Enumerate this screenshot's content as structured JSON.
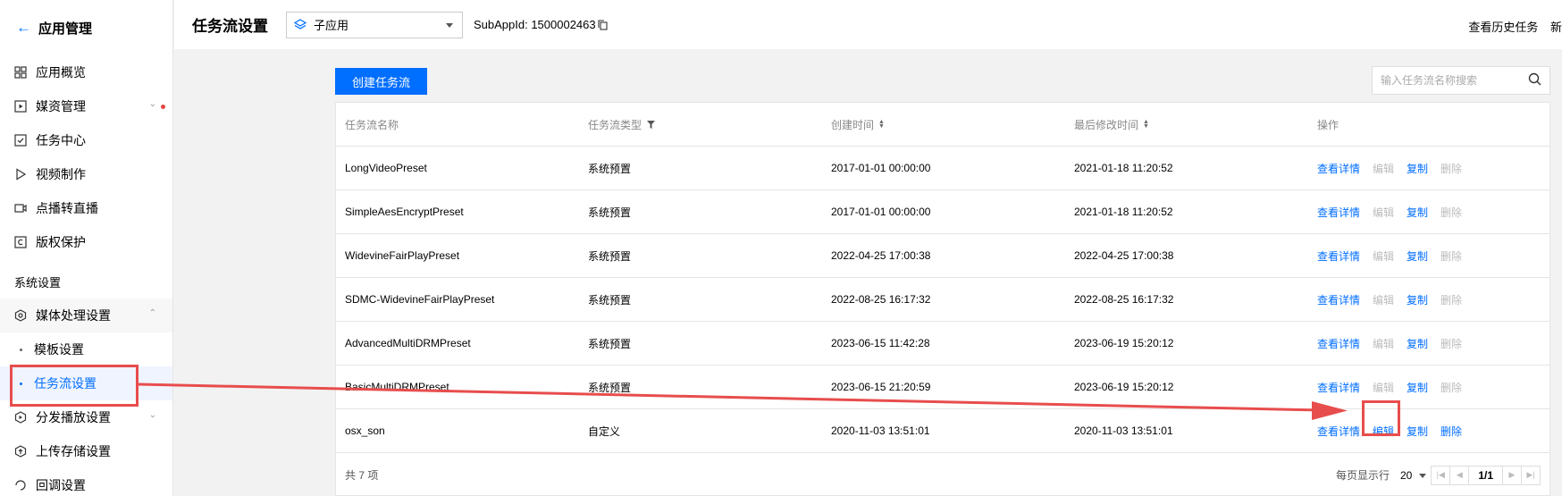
{
  "sidebar": {
    "header": "应用管理",
    "items": [
      {
        "label": "应用概览",
        "icon": "grid-icon"
      },
      {
        "label": "媒资管理",
        "icon": "media-play-icon"
      },
      {
        "label": "任务中心",
        "icon": "task-check-icon"
      },
      {
        "label": "视频制作",
        "icon": "play-triangle-icon"
      },
      {
        "label": "点播转直播",
        "icon": "live-video-icon"
      },
      {
        "label": "版权保护",
        "icon": "copyright-icon"
      }
    ],
    "group_title": "系统设置",
    "settings": [
      {
        "label": "媒体处理设置",
        "icon": "hexagon-gear-icon"
      },
      {
        "label": "模板设置"
      },
      {
        "label": "任务流设置"
      },
      {
        "label": "分发播放设置",
        "icon": "distribute-icon"
      },
      {
        "label": "上传存储设置",
        "icon": "upload-storage-icon"
      },
      {
        "label": "回调设置",
        "icon": "callback-icon"
      }
    ]
  },
  "header": {
    "title": "任务流设置",
    "app_select_value": "子应用",
    "subappid": "SubAppId: 1500002463",
    "right_links": [
      "查看历史任务",
      "新"
    ]
  },
  "toolbar": {
    "create_label": "创建任务流",
    "search_placeholder": "输入任务流名称搜索"
  },
  "table": {
    "columns": [
      "任务流名称",
      "任务流类型",
      "创建时间",
      "最后修改时间",
      "操作"
    ],
    "rows": [
      {
        "name": "LongVideoPreset",
        "type": "系统预置",
        "created": "2017-01-01 00:00:00",
        "modified": "2021-01-18 11:20:52",
        "custom": false
      },
      {
        "name": "SimpleAesEncryptPreset",
        "type": "系统预置",
        "created": "2017-01-01 00:00:00",
        "modified": "2021-01-18 11:20:52",
        "custom": false
      },
      {
        "name": "WidevineFairPlayPreset",
        "type": "系统预置",
        "created": "2022-04-25 17:00:38",
        "modified": "2022-04-25 17:00:38",
        "custom": false
      },
      {
        "name": "SDMC-WidevineFairPlayPreset",
        "type": "系统预置",
        "created": "2022-08-25 16:17:32",
        "modified": "2022-08-25 16:17:32",
        "custom": false
      },
      {
        "name": "AdvancedMultiDRMPreset",
        "type": "系统预置",
        "created": "2023-06-15 11:42:28",
        "modified": "2023-06-19 15:20:12",
        "custom": false
      },
      {
        "name": "BasicMultiDRMPreset",
        "type": "系统预置",
        "created": "2023-06-15 21:20:59",
        "modified": "2023-06-19 15:20:12",
        "custom": false
      },
      {
        "name": "osx_son",
        "type": "自定义",
        "created": "2020-11-03 13:51:01",
        "modified": "2020-11-03 13:51:01",
        "custom": true
      }
    ],
    "actions": [
      "查看详情",
      "编辑",
      "复制",
      "删除"
    ]
  },
  "footer": {
    "total": "共 7 项",
    "page_size_label": "每页显示行",
    "page_size": "20",
    "page": "1/1"
  },
  "colors": {
    "accent": "#006eff",
    "annotation": "#e84d4d",
    "disabled": "#bbbbbb"
  }
}
